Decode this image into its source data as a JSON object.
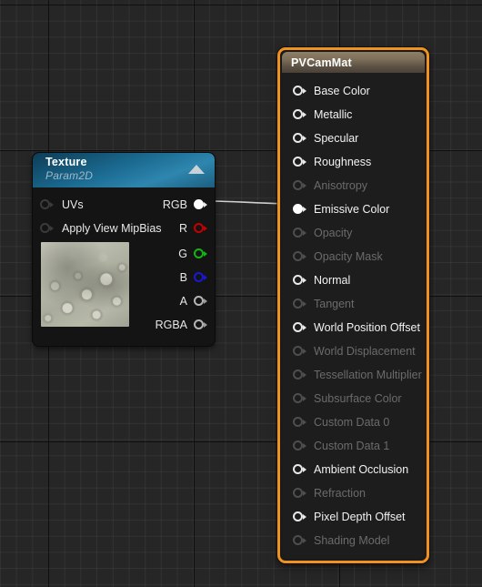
{
  "app": {
    "name": "material-graph-editor",
    "background_color": "#262626",
    "grid_minor_color": "#303030",
    "grid_major_color": "#0a0a0a"
  },
  "wire": {
    "name": "rgb-to-emissive-color-wire",
    "color": "#d8d8d8",
    "from_pin": "RGB",
    "to_pin": "Emissive Color"
  },
  "texture_node": {
    "title": "Texture",
    "subtitle": "Param2D",
    "header_color": "#1b6a91",
    "collapse_icon": "triangle-up-icon",
    "inputs": [
      {
        "label": "UVs",
        "pin": "pin-uvs",
        "state": "dark"
      },
      {
        "label": "Apply View MipBias",
        "pin": "pin-apply-view-mipbias",
        "state": "dark"
      }
    ],
    "outputs": [
      {
        "label": "RGB",
        "pin": "pin-rgb",
        "state": "solid",
        "color": "#ffffff"
      },
      {
        "label": "R",
        "pin": "pin-r",
        "state": "red",
        "color": "#c40000"
      },
      {
        "label": "G",
        "pin": "pin-g",
        "state": "green",
        "color": "#12b512"
      },
      {
        "label": "B",
        "pin": "pin-b",
        "state": "blue",
        "color": "#1818d8"
      },
      {
        "label": "A",
        "pin": "pin-a",
        "state": "grey",
        "color": "#b5b5b5"
      },
      {
        "label": "RGBA",
        "pin": "pin-rgba",
        "state": "grey",
        "color": "#b5b5b5"
      }
    ],
    "thumbnail": "texture-preview-thumbnail"
  },
  "material_node": {
    "title": "PVCamMat",
    "border_color": "#f0931e",
    "header_color": "#7b6d57",
    "inputs": [
      {
        "label": "Base Color",
        "enabled": true
      },
      {
        "label": "Metallic",
        "enabled": true
      },
      {
        "label": "Specular",
        "enabled": true
      },
      {
        "label": "Roughness",
        "enabled": true
      },
      {
        "label": "Anisotropy",
        "enabled": false
      },
      {
        "label": "Emissive Color",
        "enabled": true,
        "connected": true
      },
      {
        "label": "Opacity",
        "enabled": false
      },
      {
        "label": "Opacity Mask",
        "enabled": false
      },
      {
        "label": "Normal",
        "enabled": true
      },
      {
        "label": "Tangent",
        "enabled": false
      },
      {
        "label": "World Position Offset",
        "enabled": true
      },
      {
        "label": "World Displacement",
        "enabled": false
      },
      {
        "label": "Tessellation Multiplier",
        "enabled": false
      },
      {
        "label": "Subsurface Color",
        "enabled": false
      },
      {
        "label": "Custom Data 0",
        "enabled": false
      },
      {
        "label": "Custom Data 1",
        "enabled": false
      },
      {
        "label": "Ambient Occlusion",
        "enabled": true
      },
      {
        "label": "Refraction",
        "enabled": false
      },
      {
        "label": "Pixel Depth Offset",
        "enabled": true
      },
      {
        "label": "Shading Model",
        "enabled": false
      }
    ]
  }
}
